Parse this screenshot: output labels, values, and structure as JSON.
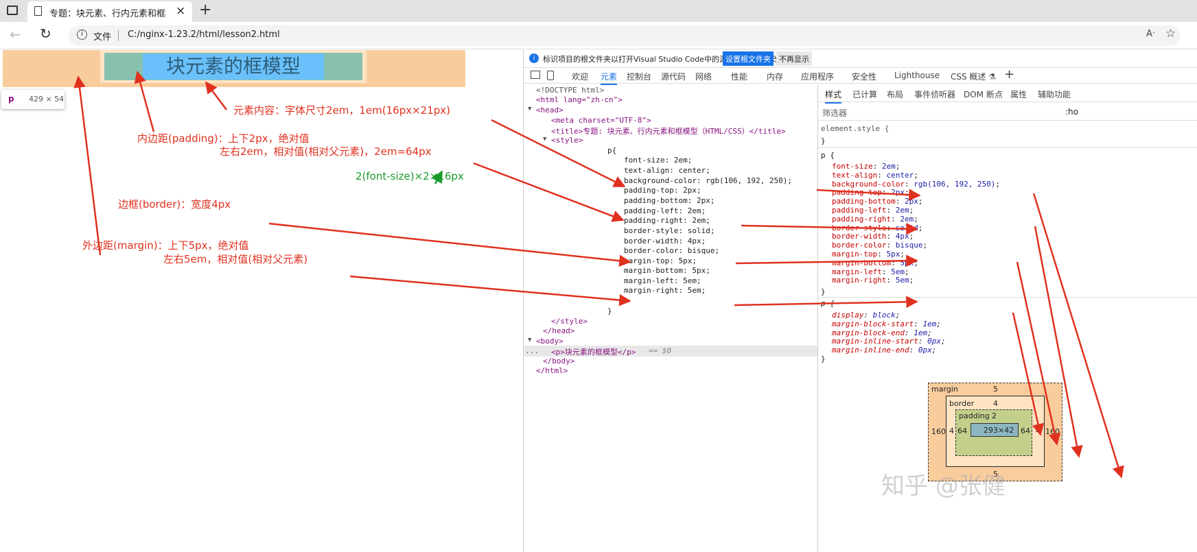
{
  "browser": {
    "tab_title": "专题：块元素、行内元素和框模型",
    "tab_new": "+",
    "close_glyph": "×",
    "file_label": "文件",
    "url": "C:/nginx-1.23.2/html/lesson2.html",
    "read_aloud": "A⁾"
  },
  "page": {
    "demo_text": "块元素的框模型",
    "tooltip_tag": "p",
    "tooltip_size": "429 × 54"
  },
  "annotations": {
    "content": "元素内容：字体尺寸2em，1em(16px×21px)",
    "padding1": "内边距(padding)：上下2px，绝对值",
    "padding2": "左右2em，相对值(相对父元素)，2em=64px",
    "font_calc": "2(font-size)×2×16px",
    "border": "边框(border)：宽度4px",
    "margin1": "外边距(margin)：上下5px，绝对值",
    "margin2": "左右5em，相对值(相对父元素)"
  },
  "devtools": {
    "info_bar": "标识项目的根文件夹以打开Visual Studio Code中的源文件并同步更改。",
    "set_root_button": "设置根文件夹",
    "dismiss_button": "不再显示",
    "tabs": [
      "欢迎",
      "元素",
      "控制台",
      "源代码",
      "网络",
      "性能",
      "内存",
      "应用程序",
      "安全性",
      "Lighthouse",
      "CSS 概述 ⚗"
    ],
    "add_tab": "+",
    "right_tabs": [
      "样式",
      "已计算",
      "布局",
      "事件侦听器",
      "DOM 断点",
      "属性",
      "辅助功能"
    ],
    "filter_placeholder": "筛选器",
    "filter_suffix": ":ho",
    "dom": {
      "doctype": "<!DOCTYPE html>",
      "html_open": "<html lang=\"zh-cn\">",
      "head_open": "<head>",
      "meta": "<meta charset=\"UTF-8\">",
      "title_line": "<title>专题: 块元素、行内元素和框模型（HTML/CSS）</title>",
      "style_open": "<style>",
      "rule_selector": "p{",
      "rule_props": [
        "font-size: 2em;",
        "text-align: center;",
        "background-color: rgb(106, 192, 250);",
        "padding-top: 2px;",
        "padding-bottom: 2px;",
        "padding-left: 2em;",
        "padding-right: 2em;",
        "border-style: solid;",
        "border-width: 4px;",
        "border-color: bisque;",
        "margin-top: 5px;",
        "margin-bottom: 5px;",
        "margin-left: 5em;",
        "margin-right: 5em;"
      ],
      "rule_close": "}",
      "style_close": "</style>",
      "head_close": "</head>",
      "body_open": "<body>",
      "p_line": "<p>块元素的框模型</p>",
      "p_suffix": "== $0",
      "dots": "...",
      "body_close": "</body>",
      "html_close": "</html>"
    },
    "styles": {
      "element_style": "element.style {",
      "element_close": "}",
      "p_selector": "p {",
      "p_props": [
        {
          "n": "font-size",
          "v": "2em"
        },
        {
          "n": "text-align",
          "v": "center"
        },
        {
          "n": "background-color",
          "v": "rgb(106, 192, 250)"
        },
        {
          "n": "padding-top",
          "v": "2px"
        },
        {
          "n": "padding-bottom",
          "v": "2px"
        },
        {
          "n": "padding-left",
          "v": "2em"
        },
        {
          "n": "padding-right",
          "v": "2em"
        },
        {
          "n": "border-style",
          "v": "solid"
        },
        {
          "n": "border-width",
          "v": "4px"
        },
        {
          "n": "border-color",
          "v": "bisque"
        },
        {
          "n": "margin-top",
          "v": "5px"
        },
        {
          "n": "margin-bottom",
          "v": "5px"
        },
        {
          "n": "margin-left",
          "v": "5em"
        },
        {
          "n": "margin-right",
          "v": "5em"
        }
      ],
      "ua_selector": "p {",
      "ua_props": [
        {
          "n": "display",
          "v": "block"
        },
        {
          "n": "margin-block-start",
          "v": "1em"
        },
        {
          "n": "margin-block-end",
          "v": "1em"
        },
        {
          "n": "margin-inline-start",
          "v": "0px"
        },
        {
          "n": "margin-inline-end",
          "v": "0px"
        }
      ],
      "close": "}"
    },
    "box_model": {
      "margin_label": "margin",
      "margin_top": "5",
      "margin_bottom": "5",
      "margin_left": "160",
      "margin_right": "160",
      "border_label": "border",
      "border_top": "4",
      "border_left": "4",
      "border_right": "4",
      "padding_label": "padding",
      "padding_top": "2",
      "padding_left": "64",
      "padding_right": "64",
      "content": "293×42"
    },
    "watermark": "知乎 @张健"
  },
  "colors": {
    "content_bg": "#6ac0fa",
    "border": "#ffe4c4",
    "margin_highlight": "#f9cc9d",
    "padding_highlight": "#c3d08b",
    "content_highlight": "#8cb6c0",
    "annotation_red": "#e0301e",
    "annotation_green": "#1a9a2a"
  }
}
